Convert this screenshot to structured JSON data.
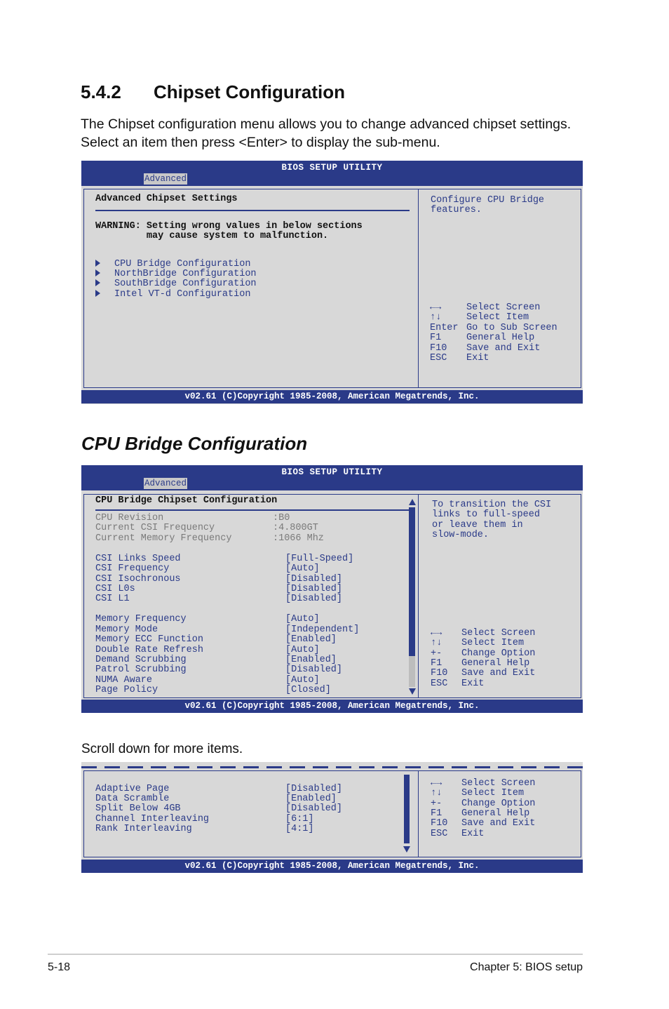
{
  "section": {
    "number": "5.4.2",
    "title": "Chipset Configuration"
  },
  "intro": {
    "line1": "The Chipset configuration menu allows you to change advanced chipset settings.",
    "line2": "Select an item then press <Enter> to display the sub-menu."
  },
  "bios_common": {
    "title": "BIOS SETUP UTILITY",
    "tab": "Advanced",
    "copyright": "v02.61 (C)Copyright 1985-2008, American Megatrends, Inc."
  },
  "screen1": {
    "heading": "Advanced Chipset Settings",
    "warning1": "WARNING: Setting wrong values in below sections",
    "warning2": "         may cause system to malfunction.",
    "items": [
      "CPU Bridge Configuration",
      "NorthBridge Configuration",
      "SouthBridge Configuration",
      "Intel VT-d Configuration"
    ],
    "help1": "Configure CPU Bridge",
    "help2": "features.",
    "keys": [
      {
        "key": "←→",
        "desc": "Select Screen"
      },
      {
        "key": "↑↓",
        "desc": "Select Item"
      },
      {
        "key": "Enter",
        "desc": "Go to Sub Screen"
      },
      {
        "key": "F1",
        "desc": "General Help"
      },
      {
        "key": "F10",
        "desc": "Save and Exit"
      },
      {
        "key": "ESC",
        "desc": "Exit"
      }
    ]
  },
  "subtitle": "CPU Bridge Configuration",
  "screen2": {
    "heading": "CPU Bridge Chipset Configuration",
    "info": [
      {
        "label": "CPU Revision",
        "value": ":B0"
      },
      {
        "label": "Current CSI Frequency",
        "value": ":4.800GT"
      },
      {
        "label": "Current Memory Frequency",
        "value": ":1066 Mhz"
      }
    ],
    "csi": [
      {
        "label": "CSI Links Speed",
        "value": "[Full-Speed]"
      },
      {
        "label": "CSI Frequency",
        "value": "[Auto]"
      },
      {
        "label": "CSI Isochronous",
        "value": "[Disabled]"
      },
      {
        "label": "CSI L0s",
        "value": "[Disabled]"
      },
      {
        "label": "CSI L1",
        "value": "[Disabled]"
      }
    ],
    "memory": [
      {
        "label": "Memory Frequency",
        "value": "[Auto]"
      },
      {
        "label": "Memory Mode",
        "value": "[Independent]"
      },
      {
        "label": "Memory ECC Function",
        "value": "[Enabled]"
      },
      {
        "label": "Double Rate Refresh",
        "value": "[Auto]"
      },
      {
        "label": "Demand Scrubbing",
        "value": "[Enabled]"
      },
      {
        "label": "Patrol Scrubbing",
        "value": "[Disabled]"
      },
      {
        "label": "NUMA Aware",
        "value": "[Auto]"
      },
      {
        "label": "Page Policy",
        "value": "[Closed]"
      }
    ],
    "help": [
      "To transition the CSI",
      "links to full-speed",
      "or leave them in",
      "slow-mode."
    ],
    "keys": [
      {
        "key": "←→",
        "desc": "Select Screen"
      },
      {
        "key": "↑↓",
        "desc": "Select Item"
      },
      {
        "key": "+-",
        "desc": "Change Option"
      },
      {
        "key": "F1",
        "desc": "General Help"
      },
      {
        "key": "F10",
        "desc": "Save and Exit"
      },
      {
        "key": "ESC",
        "desc": "Exit"
      }
    ]
  },
  "scroll_note": "Scroll down for more items.",
  "screen3": {
    "items": [
      {
        "label": "Adaptive Page",
        "value": "[Disabled]"
      },
      {
        "label": "Data Scramble",
        "value": "[Enabled]"
      },
      {
        "label": "Split Below 4GB",
        "value": "[Disabled]"
      },
      {
        "label": "Channel Interleaving",
        "value": "[6:1]"
      },
      {
        "label": "Rank Interleaving",
        "value": "[4:1]"
      }
    ],
    "keys": [
      {
        "key": "←→",
        "desc": "Select Screen"
      },
      {
        "key": "↑↓",
        "desc": "Select Item"
      },
      {
        "key": "+-",
        "desc": "Change Option"
      },
      {
        "key": "F1",
        "desc": "General Help"
      },
      {
        "key": "F10",
        "desc": "Save and Exit"
      },
      {
        "key": "ESC",
        "desc": "Exit"
      }
    ]
  },
  "footer": {
    "page": "5-18",
    "chapter": "Chapter 5: BIOS setup"
  }
}
